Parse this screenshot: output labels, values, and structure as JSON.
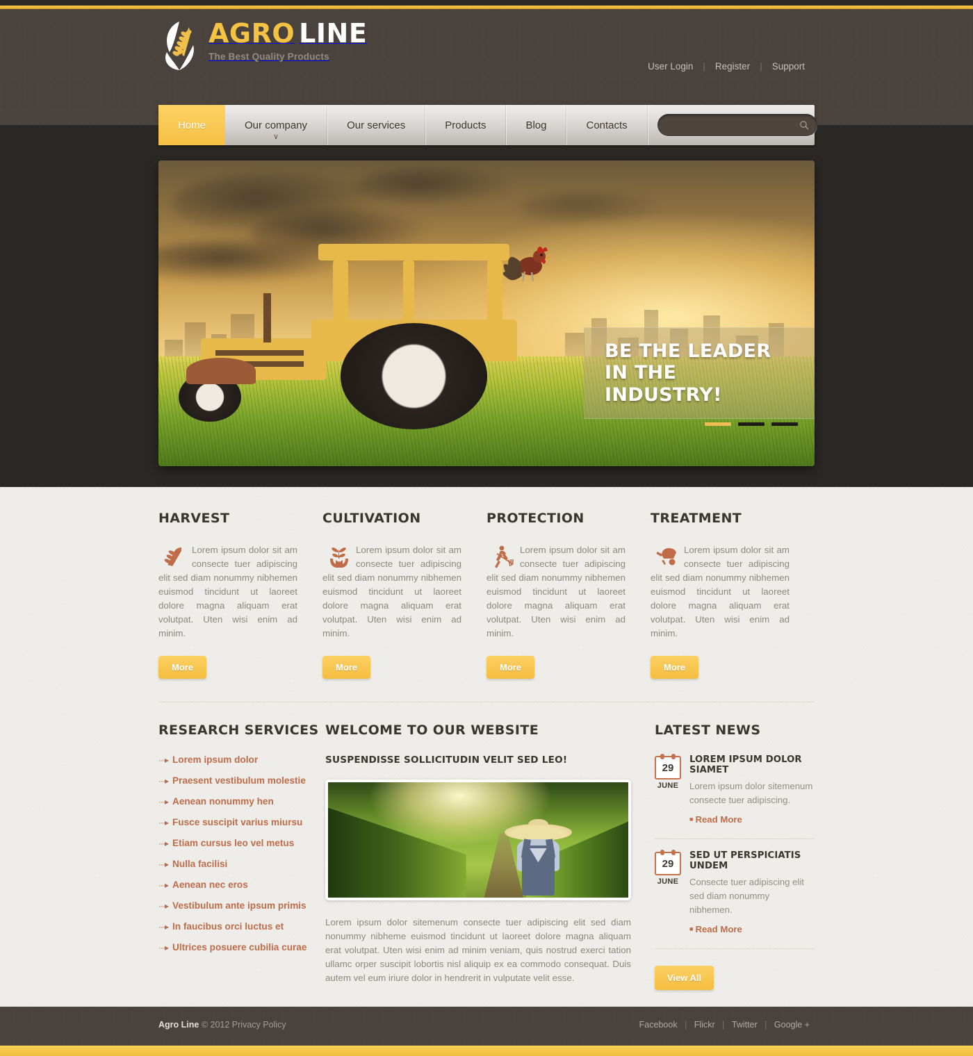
{
  "brand": {
    "name_part1": "AGRO",
    "name_part2": "LINE",
    "tagline": "The Best Quality Products",
    "logo_icon": "wheat-leaf-icon"
  },
  "topbar": {
    "links": [
      {
        "label": "User Login"
      },
      {
        "label": "Register"
      },
      {
        "label": "Support"
      }
    ],
    "separator": "|"
  },
  "nav": {
    "items": [
      {
        "label": "Home",
        "active": true,
        "has_caret": false
      },
      {
        "label": "Our company",
        "active": false,
        "has_caret": true
      },
      {
        "label": "Our services",
        "active": false,
        "has_caret": false
      },
      {
        "label": "Products",
        "active": false,
        "has_caret": false
      },
      {
        "label": "Blog",
        "active": false,
        "has_caret": false
      },
      {
        "label": "Contacts",
        "active": false,
        "has_caret": false
      }
    ],
    "caret_glyph": "∨"
  },
  "search": {
    "value": "",
    "placeholder": "",
    "icon": "search-icon"
  },
  "hero": {
    "caption": "BE THE LEADER IN THE INDUSTRY!",
    "image_alt": "yellow tractor in a field at sunset with a rooster perched on the cab roof and a city skyline behind",
    "slides": [
      {
        "active": true
      },
      {
        "active": false
      },
      {
        "active": false
      }
    ]
  },
  "services": [
    {
      "title": "HARVEST",
      "icon": "wheat-icon",
      "text": "Lorem ipsum dolor sit am consecte tuer adipiscing elit sed diam nonummy nibhemen euismod tincidunt ut laoreet dolore magna aliquam erat volutpat. Uten wisi enim ad minim.",
      "button": "More"
    },
    {
      "title": "CULTIVATION",
      "icon": "hands-plant-icon",
      "text": "Lorem ipsum dolor sit am consecte tuer adipiscing elit sed diam nonummy nibhemen euismod tincidunt ut laoreet dolore magna aliquam erat volutpat. Uten wisi enim ad minim.",
      "button": "More"
    },
    {
      "title": "PROTECTION",
      "icon": "farmer-pitchfork-icon",
      "text": "Lorem ipsum dolor sit am consecte tuer adipiscing elit sed diam nonummy nibhemen euismod tincidunt ut laoreet dolore magna aliquam erat volutpat. Uten wisi enim ad minim.",
      "button": "More"
    },
    {
      "title": "TREATMENT",
      "icon": "wheelbarrow-icon",
      "text": "Lorem ipsum dolor sit am consecte tuer adipiscing elit sed diam nonummy nibhemen euismod tincidunt ut laoreet dolore magna aliquam erat volutpat. Uten wisi enim ad minim.",
      "button": "More"
    }
  ],
  "research": {
    "title": "RESEARCH SERVICES",
    "bullet": "···▸",
    "items": [
      {
        "label": "Lorem ipsum dolor"
      },
      {
        "label": "Praesent vestibulum molestie"
      },
      {
        "label": "Aenean nonummy hen"
      },
      {
        "label": "Fusce suscipit varius miursu"
      },
      {
        "label": "Etiam cursus leo vel metus"
      },
      {
        "label": "Nulla facilisi"
      },
      {
        "label": "Aenean nec eros"
      },
      {
        "label": "Vestibulum ante ipsum primis"
      },
      {
        "label": "In faucibus orci luctus et"
      },
      {
        "label": "Ultrices posuere cubilia curae"
      }
    ]
  },
  "welcome": {
    "title": "WELCOME TO OUR WEBSITE",
    "subtitle": "SUSPENDISSE SOLLICITUDIN VELIT SED LEO!",
    "image_alt": "farmer in straw hat and overalls walking along a path between rows of corn at sunrise",
    "text": "Lorem ipsum dolor sitemenum consecte tuer adipiscing elit sed diam nonummy nibheme euismod tincidunt ut laoreet dolore magna aliquam erat volutpat. Uten wisi enim ad minim veniam, quis nostrud exerci tation ullamc orper suscipit lobortis nisl aliquip ex ea commodo consequat. Duis autem vel eum iriure dolor in hendrerit in vulputate velit esse."
  },
  "news": {
    "title": "LATEST NEWS",
    "items": [
      {
        "day": "29",
        "month": "JUNE",
        "title": "LOREM IPSUM DOLOR SIAMET",
        "text": "Lorem ipsum dolor sitemenum consecte tuer adipiscing.",
        "read_more": "Read More"
      },
      {
        "day": "29",
        "month": "JUNE",
        "title": "SED UT PERSPICIATIS UNDEM",
        "text": "Consecte tuer adipiscing elit sed diam nonummy nibhemen.",
        "read_more": "Read More"
      }
    ],
    "view_all": "View All"
  },
  "footer": {
    "brand": "Agro Line",
    "copyright": "© 2012 Privacy Policy",
    "social": [
      {
        "label": "Facebook"
      },
      {
        "label": "Flickr"
      },
      {
        "label": "Twitter"
      },
      {
        "label": "Google +"
      }
    ],
    "separator": "|"
  },
  "colors": {
    "accent_gold": "#f4c344",
    "header_brown": "#4a423d",
    "hero_dark": "#2b2724",
    "content_bg": "#efeeea",
    "link_rust": "#c06c49",
    "heading_dark": "#3a3531",
    "body_gray": "#8d8781"
  }
}
